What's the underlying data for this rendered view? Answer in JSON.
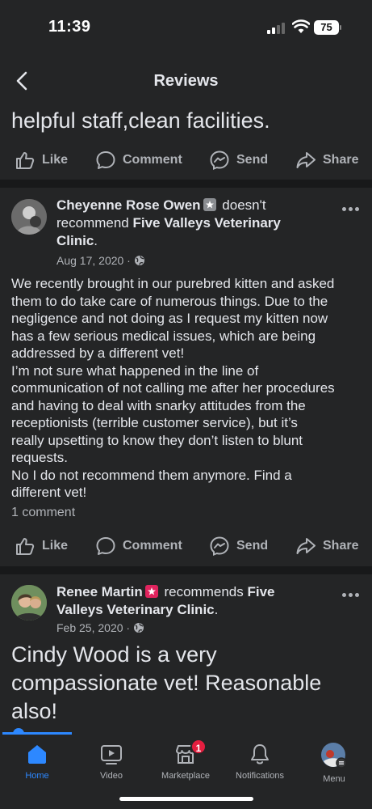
{
  "status_bar": {
    "time": "11:39",
    "battery": "75"
  },
  "header": {
    "title": "Reviews"
  },
  "previous_post": {
    "text_tail": "helpful staff,clean facilities."
  },
  "actions": {
    "like": "Like",
    "comment": "Comment",
    "send": "Send",
    "share": "Share"
  },
  "posts": [
    {
      "name": "Cheyenne Rose Owen",
      "verb": "doesn't recommend",
      "page": "Five Valleys Veterinary Clinic",
      "date": "Aug 17, 2020 ·",
      "body": [
        "We recently brought in our purebred kitten and asked",
        "them to do take care of numerous things. Due to the",
        "negligence and not doing as I request my kitten now",
        "has a few serious medical issues, which are being",
        "addressed by a different vet!",
        "I’m not sure what happened in the line of",
        "communication of not calling me after her procedures",
        "and having to deal with snarky attitudes from the",
        "receptionists (terrible customer service), but it’s",
        "really upsetting to know they don’t listen to blunt",
        "requests.",
        "No I do not recommend them anymore. Find a",
        "different vet!"
      ],
      "comments": "1 comment"
    },
    {
      "name": "Renee Martin",
      "verb": "recommends",
      "page": "Five Valleys Veterinary Clinic",
      "date": "Feb 25, 2020 ·",
      "body": "Cindy Wood is a very compassionate vet! Reasonable also!"
    }
  ],
  "bottom_nav": {
    "items": [
      {
        "label": "Home",
        "icon": "home-icon",
        "active": true
      },
      {
        "label": "Video",
        "icon": "video-icon"
      },
      {
        "label": "Marketplace",
        "icon": "marketplace-icon",
        "badge": "1"
      },
      {
        "label": "Notifications",
        "icon": "bell-icon"
      },
      {
        "label": "Menu",
        "icon": "menu-avatar-icon"
      }
    ]
  },
  "colors": {
    "background": "#242526",
    "divider": "#18191a",
    "text_primary": "#e4e6eb",
    "text_secondary": "#b0b3b8",
    "accent": "#2d88ff",
    "badge": "#e41e3f",
    "recommend_badge": "#e0245e",
    "not_recommend_badge": "#8a8d91"
  }
}
